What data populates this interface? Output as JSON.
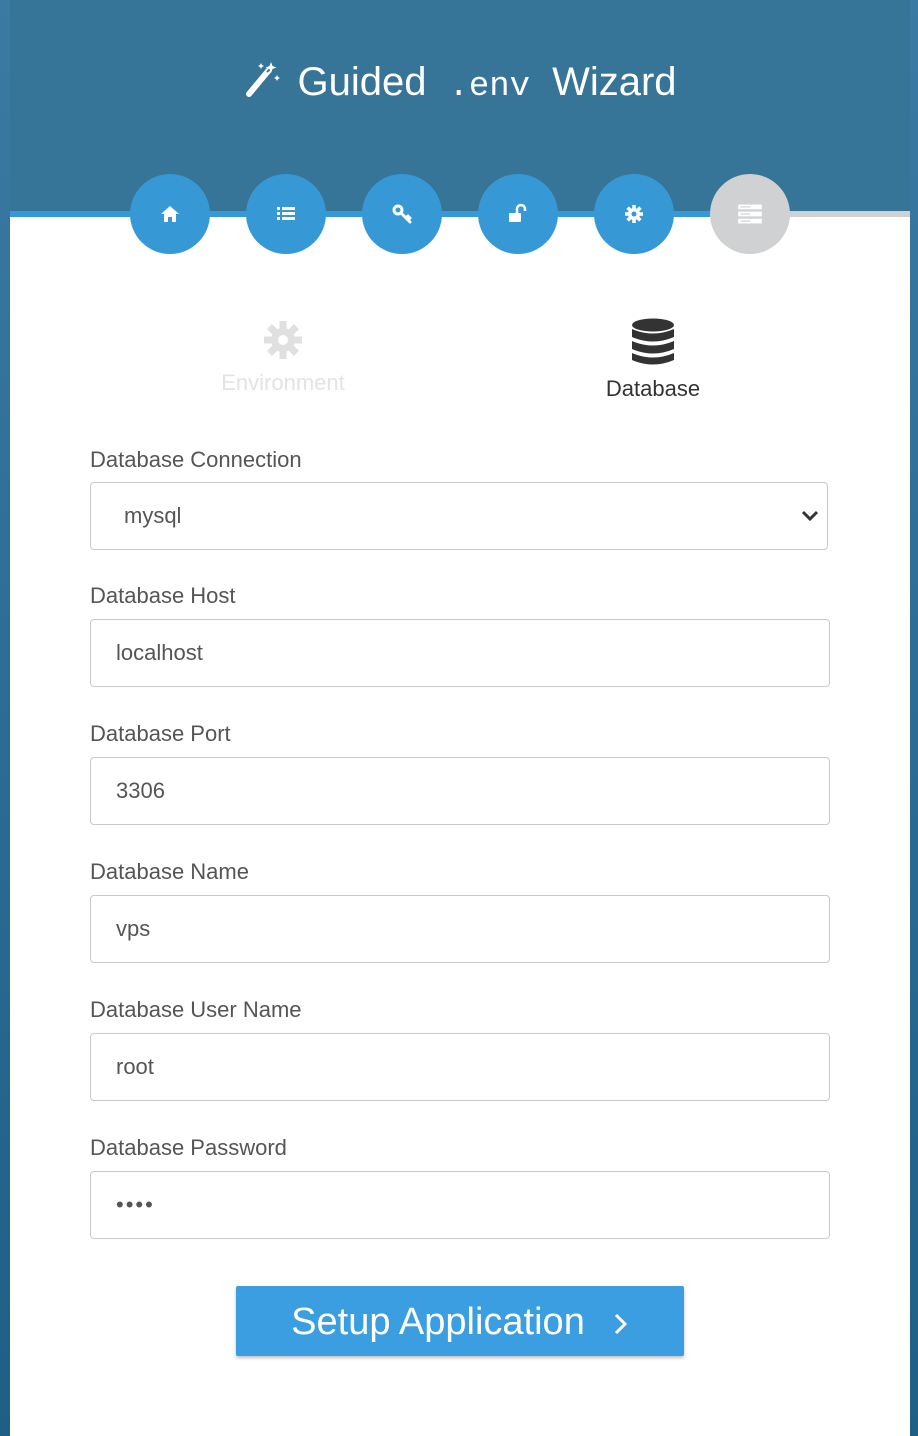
{
  "header": {
    "title_prefix": "Guided",
    "title_env": ".env",
    "title_suffix": "Wizard",
    "bg_color": "#367498"
  },
  "steps": [
    {
      "icon": "home-icon",
      "state": "done"
    },
    {
      "icon": "list-icon",
      "state": "done"
    },
    {
      "icon": "key-icon",
      "state": "done"
    },
    {
      "icon": "unlock-icon",
      "state": "done"
    },
    {
      "icon": "gear-icon",
      "state": "done"
    },
    {
      "icon": "server-icon",
      "state": "pending"
    }
  ],
  "tabs": [
    {
      "label": "Environment",
      "icon": "gear-icon",
      "active": false
    },
    {
      "label": "Database",
      "icon": "database-icon",
      "active": true
    }
  ],
  "form": {
    "connection": {
      "label": "Database Connection",
      "value": "mysql"
    },
    "host": {
      "label": "Database Host",
      "value": "localhost"
    },
    "port": {
      "label": "Database Port",
      "value": "3306"
    },
    "name": {
      "label": "Database Name",
      "value": "vps"
    },
    "username": {
      "label": "Database User Name",
      "value": "root"
    },
    "password": {
      "label": "Database Password",
      "value": "••••"
    }
  },
  "submit": {
    "label": "Setup Application"
  },
  "colors": {
    "accent": "#3699d6",
    "inactive": "#cfd1d3",
    "button": "#3a9ee0"
  }
}
